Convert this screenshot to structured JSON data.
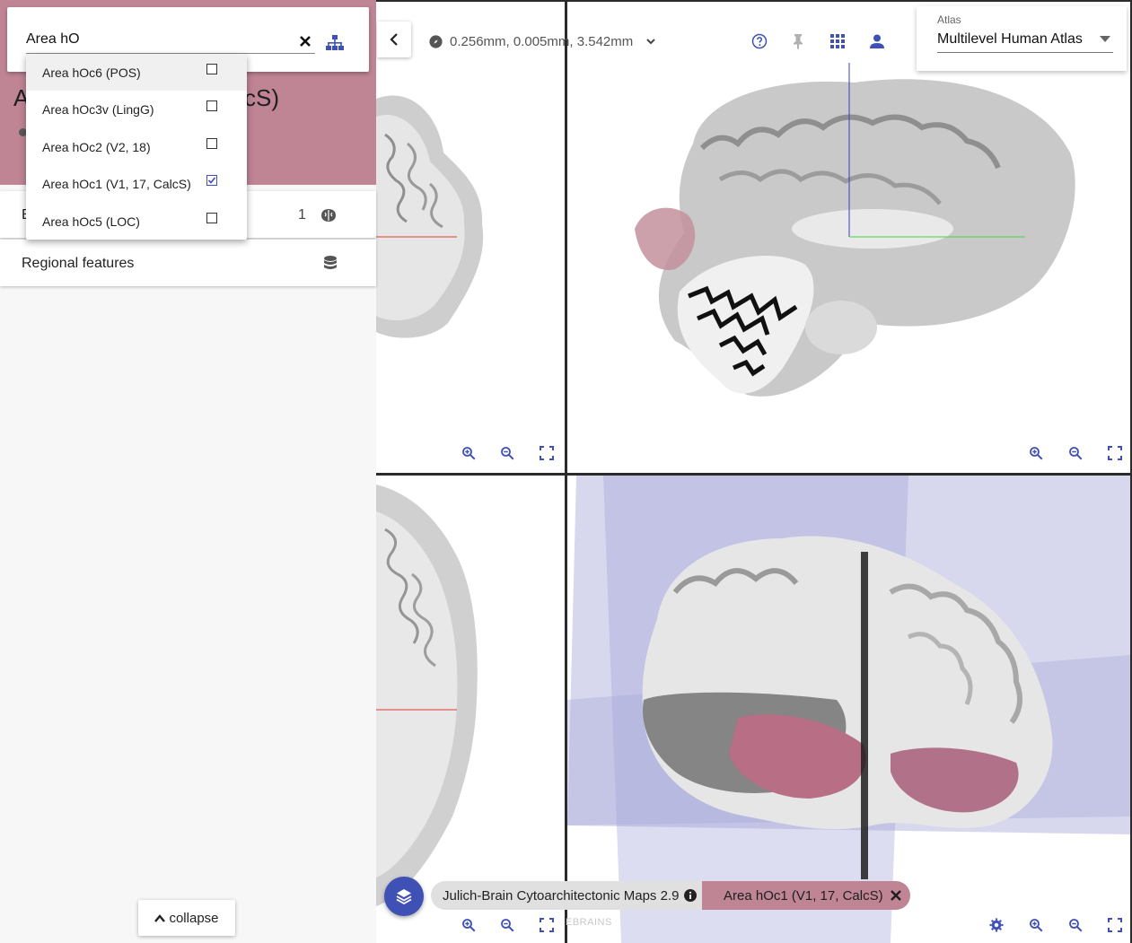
{
  "search": {
    "value": "Area hO"
  },
  "dropdown": {
    "items": [
      {
        "label": "Area hOc6 (POS)",
        "checked": false
      },
      {
        "label": "Area hOc3v (LingG)",
        "checked": false
      },
      {
        "label": "Area hOc2 (V2, 18)",
        "checked": false
      },
      {
        "label": "Area hOc1 (V1, 17, CalcS)",
        "checked": true
      },
      {
        "label": "Area hOc5 (LOC)",
        "checked": false
      }
    ]
  },
  "region": {
    "title_start": "A",
    "title_end": "cS)"
  },
  "sidebar": {
    "row1_label_start": "E",
    "row1_count": "1",
    "row2_label": "Regional features",
    "collapse_label": "collapse"
  },
  "navigation": {
    "coordinates": "0.256mm, 0.005mm, 3.542mm"
  },
  "atlas": {
    "label": "Atlas",
    "value": "Multilevel Human Atlas"
  },
  "chips": {
    "parcellation": "Julich-Brain Cytoarchitectonic Maps 2.9",
    "region": "Area hOc1 (V1, 17, CalcS)"
  },
  "watermark": "EBRAINS",
  "colors": {
    "accent": "#3f51b5",
    "region": "#bf8595",
    "cursor_red": "#e53935",
    "cursor_green": "#43d943",
    "cursor_blue": "#3c3cc8"
  }
}
